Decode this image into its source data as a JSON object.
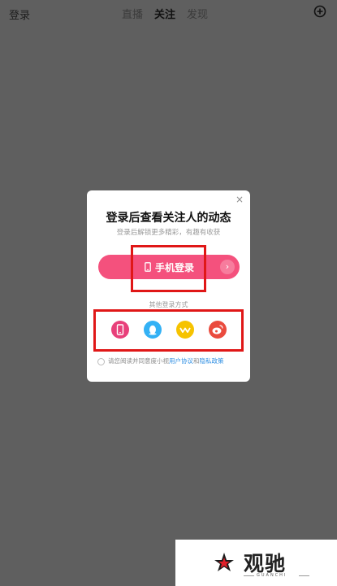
{
  "header": {
    "login_link": "登录",
    "tabs": [
      {
        "label": "直播",
        "active": false
      },
      {
        "label": "关注",
        "active": true
      },
      {
        "label": "发现",
        "active": false
      }
    ],
    "add_icon": "plus-circle-icon"
  },
  "modal": {
    "close_label": "×",
    "title": "登录后查看关注人的动态",
    "subtitle": "登录后解锁更多精彩，有趣有收获",
    "phone_login_label": "手机登录",
    "other_methods_label": "其他登录方式",
    "methods": [
      {
        "name": "phone",
        "icon": "phone-icon",
        "color": "#e8407a"
      },
      {
        "name": "qq",
        "icon": "qq-icon",
        "color": "#33b1f5"
      },
      {
        "name": "wechat",
        "icon": "wechat-icon",
        "color": "#f6c300"
      },
      {
        "name": "weibo",
        "icon": "weibo-icon",
        "color": "#ea4b3e"
      }
    ],
    "agreement": {
      "prefix": "请您阅读并同意度小视",
      "user_agreement": "用户协议",
      "and": "和",
      "privacy_policy": "隐私政策"
    }
  },
  "watermark": {
    "text": "观驰",
    "subtext": "GUANCHI"
  },
  "colors": {
    "overlay": "#5f5f5f",
    "accent": "#f4517d",
    "highlight": "#e01717",
    "link": "#2f8fe3"
  }
}
